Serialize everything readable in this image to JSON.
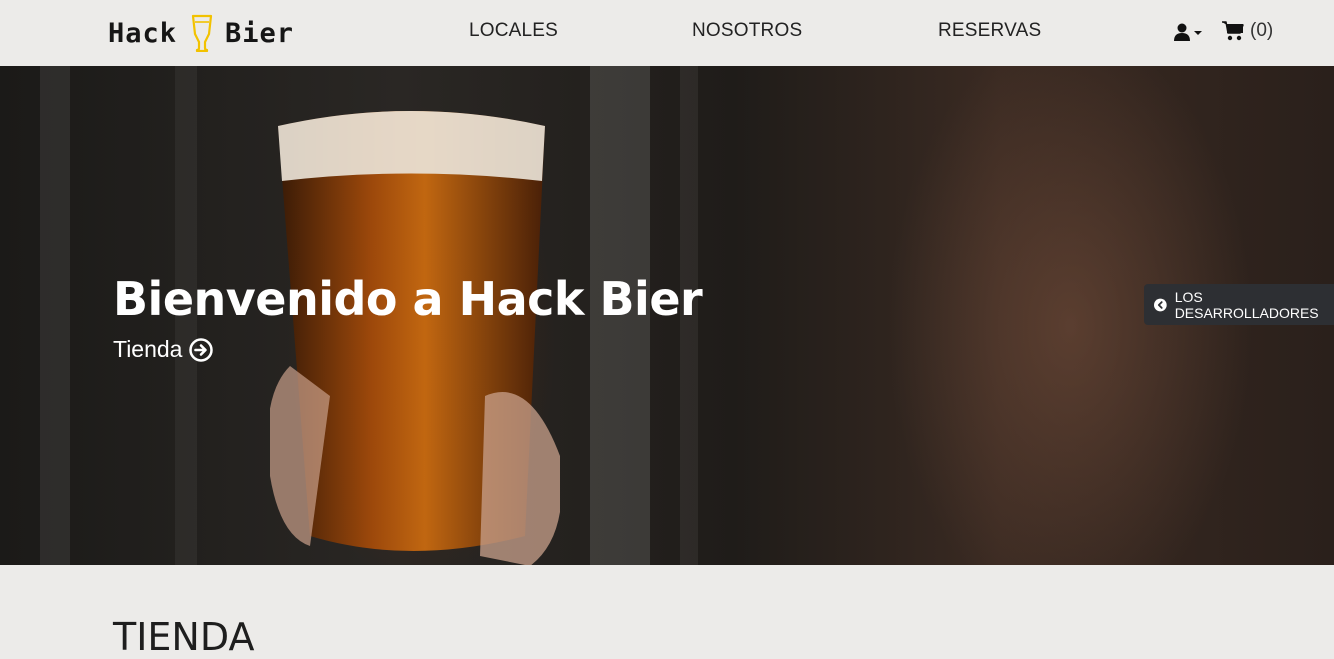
{
  "brand": {
    "left": "Hack",
    "right": "Bier",
    "icon": "beer-glass-icon"
  },
  "nav": {
    "links": [
      {
        "label": "LOCALES"
      },
      {
        "label": "NOSOTROS"
      },
      {
        "label": "RESERVAS"
      }
    ],
    "user_icon": "user-icon",
    "cart_icon": "cart-icon",
    "cart_count": "(0)"
  },
  "hero": {
    "title": "Bienvenido a Hack Bier",
    "link_label": "Tienda",
    "link_icon": "arrow-right-circle-icon",
    "dev_tab_label": "LOS DESARROLLADORES",
    "dev_tab_icon": "chevron-left-circle-icon"
  },
  "section": {
    "title": "TIENDA"
  },
  "colors": {
    "navbar_bg": "#ecebe9",
    "accent_yellow": "#f2c200",
    "dev_tab_bg": "#2d2f33"
  }
}
